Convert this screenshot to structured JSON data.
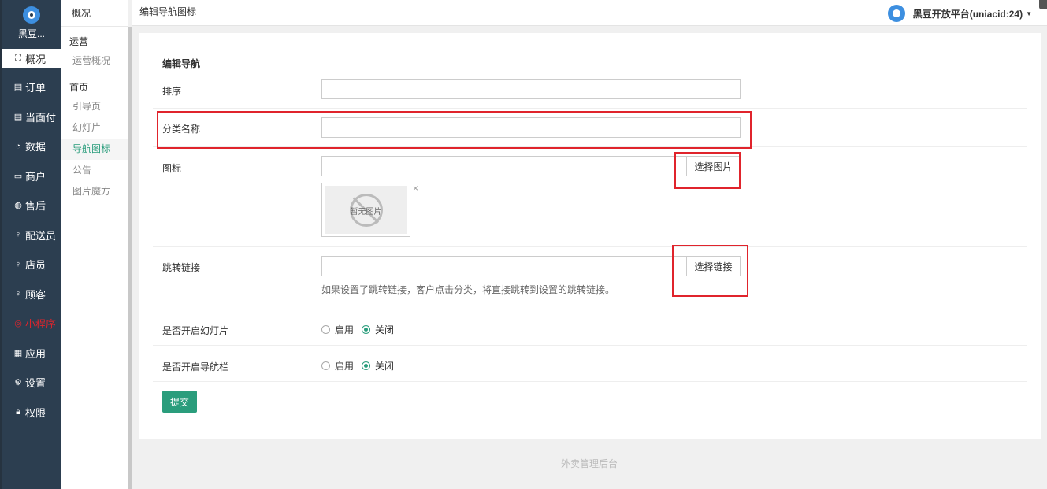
{
  "brand": {
    "name": "黑豆..."
  },
  "left_nav": [
    {
      "icon": "dashboard-icon",
      "glyph": "⛶",
      "label": "概况",
      "active": true
    },
    {
      "icon": "order-icon",
      "glyph": "▤",
      "label": "订单"
    },
    {
      "icon": "pay-icon",
      "glyph": "▤",
      "label": "当面付"
    },
    {
      "icon": "data-icon",
      "glyph": "◔",
      "label": "数据"
    },
    {
      "icon": "shop-icon",
      "glyph": "▭",
      "label": "商户"
    },
    {
      "icon": "aftersale-icon",
      "glyph": "◍",
      "label": "售后"
    },
    {
      "icon": "courier-icon",
      "glyph": "♀",
      "label": "配送员"
    },
    {
      "icon": "clerk-icon",
      "glyph": "♀",
      "label": "店员"
    },
    {
      "icon": "customer-icon",
      "glyph": "♀",
      "label": "顾客"
    },
    {
      "icon": "miniapp-icon",
      "glyph": "◎",
      "label": "小程序",
      "red": true
    },
    {
      "icon": "apps-icon",
      "glyph": "▦",
      "label": "应用"
    },
    {
      "icon": "settings-icon",
      "glyph": "⚙",
      "label": "设置"
    },
    {
      "icon": "lock-icon",
      "glyph": "🔒︎",
      "label": "权限"
    }
  ],
  "sub_nav": {
    "title": "概况",
    "groups": [
      {
        "label": "运营",
        "items": [
          {
            "label": "运营概况"
          }
        ]
      },
      {
        "label": "首页",
        "items": [
          {
            "label": "引导页"
          },
          {
            "label": "幻灯片"
          },
          {
            "label": "导航图标",
            "active": true
          },
          {
            "label": "公告"
          },
          {
            "label": "图片魔方"
          }
        ]
      }
    ]
  },
  "header": {
    "page_title": "编辑导航图标",
    "user": "黑豆开放平台(uniacid:24)"
  },
  "form": {
    "section_title": "编辑导航",
    "sort": {
      "label": "排序",
      "value": ""
    },
    "category_name": {
      "label": "分类名称",
      "value": ""
    },
    "icon": {
      "label": "图标",
      "value": "",
      "button": "选择图片",
      "no_image": "暂无图片",
      "remove": "×"
    },
    "link": {
      "label": "跳转链接",
      "value": "",
      "button": "选择链接",
      "help": "如果设置了跳转链接，客户点击分类，将直接跳转到设置的跳转链接。"
    },
    "slideshow": {
      "label": "是否开启幻灯片",
      "options": [
        "启用",
        "关闭"
      ],
      "selected": "关闭"
    },
    "navbar": {
      "label": "是否开启导航栏",
      "options": [
        "启用",
        "关闭"
      ],
      "selected": "关闭"
    },
    "submit": "提交"
  },
  "footer": "外卖管理后台",
  "colors": {
    "accent": "#2a9d7c",
    "sidebar": "#2c3e50",
    "highlight": "#e0242c"
  }
}
